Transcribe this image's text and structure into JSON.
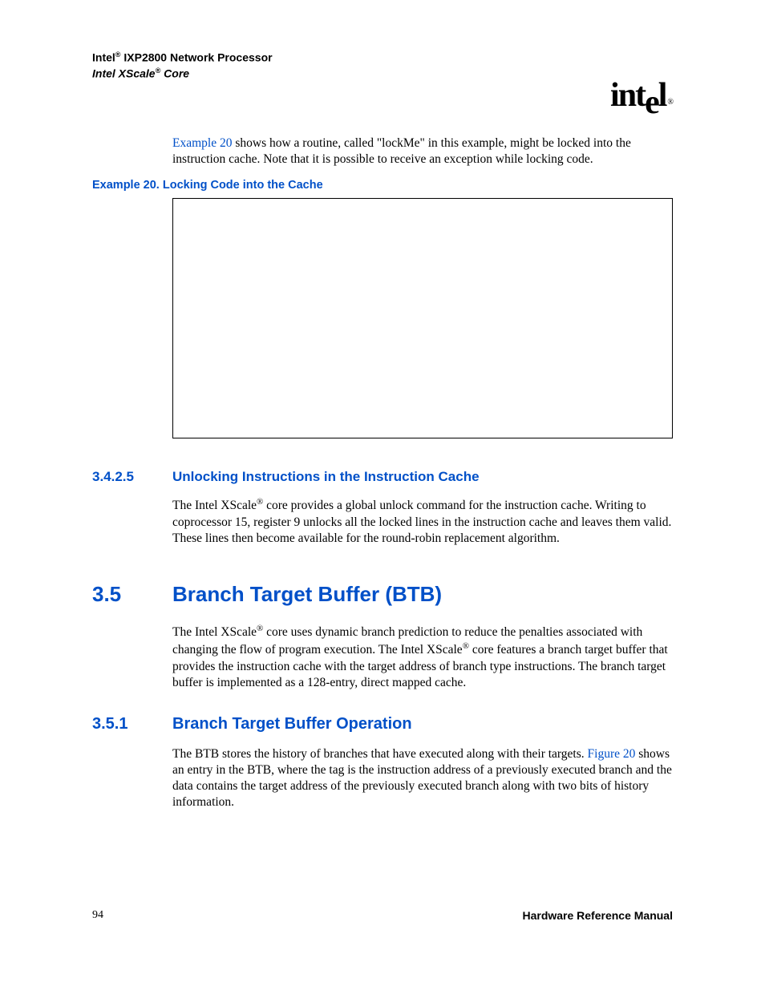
{
  "header": {
    "product_prefix": "Intel",
    "product_suffix": " IXP2800 Network Processor",
    "subtitle_prefix": "Intel XScale",
    "subtitle_suffix": " Core"
  },
  "logo": {
    "text_part1": "int",
    "text_drop": "e",
    "text_part2": "l",
    "sub": "®"
  },
  "intro": {
    "xref": "Example 20",
    "rest": " shows how a routine, called \"lockMe\" in this example, might be locked into the instruction cache. Note that it is possible to receive an exception while locking code."
  },
  "example_caption": "Example 20. Locking Code into the Cache",
  "sec_3_4_2_5": {
    "num": "3.4.2.5",
    "title": "Unlocking Instructions in the Instruction Cache",
    "para_pre": "The Intel XScale",
    "para_post": " core provides a global unlock command for the instruction cache. Writing to coprocessor 15, register 9 unlocks all the locked lines in the instruction cache and leaves them valid. These lines then become available for the round-robin replacement algorithm."
  },
  "sec_3_5": {
    "num": "3.5",
    "title": "Branch Target Buffer (BTB)",
    "para_pre1": "The Intel XScale",
    "para_mid": " core uses dynamic branch prediction to reduce the penalties associated with changing the flow of program execution. The Intel XScale",
    "para_post": " core features a branch target buffer that provides the instruction cache with the target address of branch type instructions. The branch target buffer is implemented as a 128-entry, direct mapped cache."
  },
  "sec_3_5_1": {
    "num": "3.5.1",
    "title": "Branch Target Buffer Operation",
    "para_pre": "The BTB stores the history of branches that have executed along with their targets. ",
    "xref": "Figure 20",
    "para_post": " shows an entry in the BTB, where the tag is the instruction address of a previously executed branch and the data contains the target address of the previously executed branch along with two bits of history information."
  },
  "footer": {
    "page": "94",
    "doc": "Hardware Reference Manual"
  },
  "symbols": {
    "reg": "®"
  }
}
